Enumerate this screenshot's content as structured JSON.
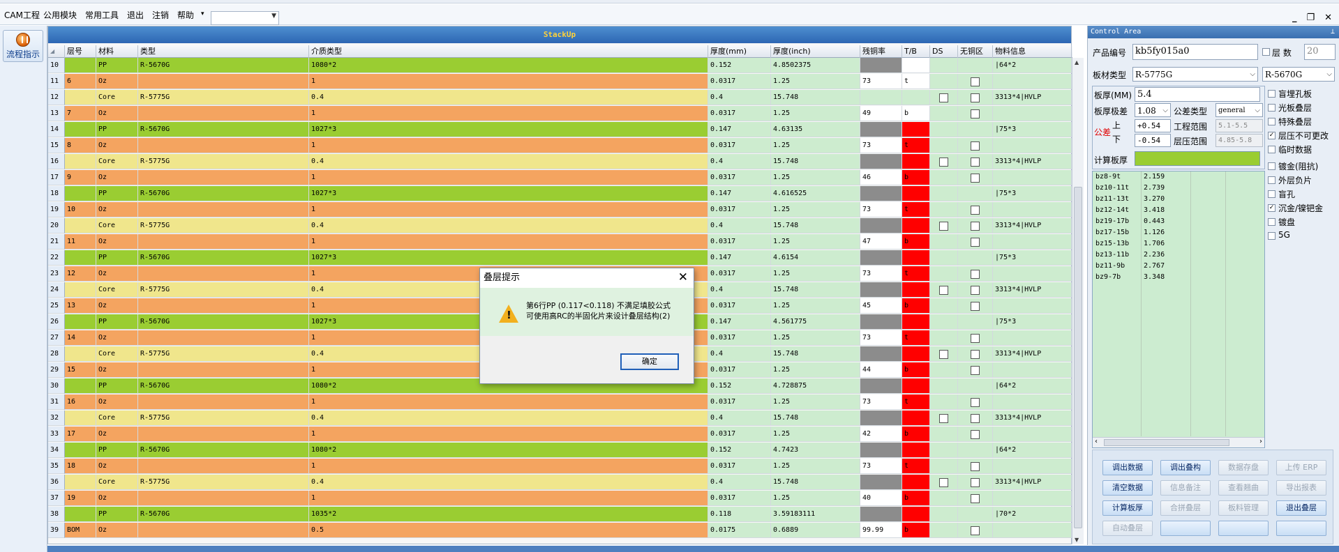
{
  "menubar": {
    "items": [
      "CAM工程",
      "公用模块",
      "常用工具",
      "退出",
      "注销",
      "帮助"
    ],
    "help_arrow": "▾"
  },
  "window_controls": [
    "_",
    "❐",
    "✕"
  ],
  "left_panel": {
    "flow_button": "流程指示"
  },
  "grid": {
    "title": "StackUp",
    "columns": [
      "层号",
      "材料",
      "类型",
      "介质类型",
      "厚度(mm)",
      "厚度(inch)",
      "残铜率",
      "T/B",
      "DS",
      "无铜区",
      "物料信息"
    ],
    "rows": [
      {
        "num": "10",
        "layer": "",
        "mat": "PP",
        "type": "R-5670G",
        "diel": "1080*2",
        "mm": "0.152",
        "inch": "4.8502375",
        "cu": "",
        "cuStyle": "gray",
        "tb": "",
        "tbStyle": "white",
        "ds": false,
        "nocu": false,
        "info": "|64*2",
        "color": "green"
      },
      {
        "num": "11",
        "layer": "6",
        "mat": "Oz",
        "type": "",
        "diel": "1",
        "mm": "0.0317",
        "inch": "1.25",
        "cu": "73",
        "cuStyle": "white",
        "tb": "t",
        "tbStyle": "white",
        "ds": null,
        "nocu": true,
        "info": "",
        "color": "orange"
      },
      {
        "num": "12",
        "layer": "",
        "mat": "Core",
        "type": "R-5775G",
        "diel": "0.4",
        "mm": "0.4",
        "inch": "15.748",
        "cu": "",
        "cuStyle": "none",
        "tb": "",
        "tbStyle": "none",
        "ds": true,
        "nocu": true,
        "info": "3313*4|HVLP",
        "color": "yellow"
      },
      {
        "num": "13",
        "layer": "7",
        "mat": "Oz",
        "type": "",
        "diel": "1",
        "mm": "0.0317",
        "inch": "1.25",
        "cu": "49",
        "cuStyle": "white",
        "tb": "b",
        "tbStyle": "white",
        "ds": null,
        "nocu": true,
        "info": "",
        "color": "orange"
      },
      {
        "num": "14",
        "layer": "",
        "mat": "PP",
        "type": "R-5670G",
        "diel": "1027*3",
        "mm": "0.147",
        "inch": "4.63135",
        "cu": "",
        "cuStyle": "gray",
        "tb": "",
        "tbStyle": "red",
        "ds": false,
        "nocu": false,
        "info": "|75*3",
        "color": "green"
      },
      {
        "num": "15",
        "layer": "8",
        "mat": "Oz",
        "type": "",
        "diel": "1",
        "mm": "0.0317",
        "inch": "1.25",
        "cu": "73",
        "cuStyle": "white",
        "tb": "t",
        "tbStyle": "red",
        "ds": null,
        "nocu": true,
        "info": "",
        "color": "orange"
      },
      {
        "num": "16",
        "layer": "",
        "mat": "Core",
        "type": "R-5775G",
        "diel": "0.4",
        "mm": "0.4",
        "inch": "15.748",
        "cu": "",
        "cuStyle": "gray",
        "tb": "",
        "tbStyle": "red",
        "ds": true,
        "nocu": true,
        "info": "3313*4|HVLP",
        "color": "yellow"
      },
      {
        "num": "17",
        "layer": "9",
        "mat": "Oz",
        "type": "",
        "diel": "1",
        "mm": "0.0317",
        "inch": "1.25",
        "cu": "46",
        "cuStyle": "white",
        "tb": "b",
        "tbStyle": "red",
        "ds": null,
        "nocu": true,
        "info": "",
        "color": "orange"
      },
      {
        "num": "18",
        "layer": "",
        "mat": "PP",
        "type": "R-5670G",
        "diel": "1027*3",
        "mm": "0.147",
        "inch": "4.616525",
        "cu": "",
        "cuStyle": "gray",
        "tb": "",
        "tbStyle": "red",
        "ds": false,
        "nocu": false,
        "info": "|75*3",
        "color": "green"
      },
      {
        "num": "19",
        "layer": "10",
        "mat": "Oz",
        "type": "",
        "diel": "1",
        "mm": "0.0317",
        "inch": "1.25",
        "cu": "73",
        "cuStyle": "white",
        "tb": "t",
        "tbStyle": "red",
        "ds": null,
        "nocu": true,
        "info": "",
        "color": "orange"
      },
      {
        "num": "20",
        "layer": "",
        "mat": "Core",
        "type": "R-5775G",
        "diel": "0.4",
        "mm": "0.4",
        "inch": "15.748",
        "cu": "",
        "cuStyle": "gray",
        "tb": "",
        "tbStyle": "red",
        "ds": true,
        "nocu": true,
        "info": "3313*4|HVLP",
        "color": "yellow"
      },
      {
        "num": "21",
        "layer": "11",
        "mat": "Oz",
        "type": "",
        "diel": "1",
        "mm": "0.0317",
        "inch": "1.25",
        "cu": "47",
        "cuStyle": "white",
        "tb": "b",
        "tbStyle": "red",
        "ds": null,
        "nocu": true,
        "info": "",
        "color": "orange"
      },
      {
        "num": "22",
        "layer": "",
        "mat": "PP",
        "type": "R-5670G",
        "diel": "1027*3",
        "mm": "0.147",
        "inch": "4.6154",
        "cu": "",
        "cuStyle": "gray",
        "tb": "",
        "tbStyle": "red",
        "ds": false,
        "nocu": false,
        "info": "|75*3",
        "color": "green"
      },
      {
        "num": "23",
        "layer": "12",
        "mat": "Oz",
        "type": "",
        "diel": "1",
        "mm": "0.0317",
        "inch": "1.25",
        "cu": "73",
        "cuStyle": "white",
        "tb": "t",
        "tbStyle": "red",
        "ds": null,
        "nocu": true,
        "info": "",
        "color": "orange"
      },
      {
        "num": "24",
        "layer": "",
        "mat": "Core",
        "type": "R-5775G",
        "diel": "0.4",
        "mm": "0.4",
        "inch": "15.748",
        "cu": "",
        "cuStyle": "gray",
        "tb": "",
        "tbStyle": "red",
        "ds": true,
        "nocu": true,
        "info": "3313*4|HVLP",
        "color": "yellow"
      },
      {
        "num": "25",
        "layer": "13",
        "mat": "Oz",
        "type": "",
        "diel": "1",
        "mm": "0.0317",
        "inch": "1.25",
        "cu": "45",
        "cuStyle": "white",
        "tb": "b",
        "tbStyle": "red",
        "ds": null,
        "nocu": true,
        "info": "",
        "color": "orange"
      },
      {
        "num": "26",
        "layer": "",
        "mat": "PP",
        "type": "R-5670G",
        "diel": "1027*3",
        "mm": "0.147",
        "inch": "4.561775",
        "cu": "",
        "cuStyle": "gray",
        "tb": "",
        "tbStyle": "red",
        "ds": false,
        "nocu": false,
        "info": "|75*3",
        "color": "green"
      },
      {
        "num": "27",
        "layer": "14",
        "mat": "Oz",
        "type": "",
        "diel": "1",
        "mm": "0.0317",
        "inch": "1.25",
        "cu": "73",
        "cuStyle": "white",
        "tb": "t",
        "tbStyle": "red",
        "ds": null,
        "nocu": true,
        "info": "",
        "color": "orange"
      },
      {
        "num": "28",
        "layer": "",
        "mat": "Core",
        "type": "R-5775G",
        "diel": "0.4",
        "mm": "0.4",
        "inch": "15.748",
        "cu": "",
        "cuStyle": "gray",
        "tb": "",
        "tbStyle": "red",
        "ds": true,
        "nocu": true,
        "info": "3313*4|HVLP",
        "color": "yellow"
      },
      {
        "num": "29",
        "layer": "15",
        "mat": "Oz",
        "type": "",
        "diel": "1",
        "mm": "0.0317",
        "inch": "1.25",
        "cu": "44",
        "cuStyle": "white",
        "tb": "b",
        "tbStyle": "red",
        "ds": null,
        "nocu": true,
        "info": "",
        "color": "orange"
      },
      {
        "num": "30",
        "layer": "",
        "mat": "PP",
        "type": "R-5670G",
        "diel": "1080*2",
        "mm": "0.152",
        "inch": "4.728875",
        "cu": "",
        "cuStyle": "gray",
        "tb": "",
        "tbStyle": "red",
        "ds": false,
        "nocu": false,
        "info": "|64*2",
        "color": "green"
      },
      {
        "num": "31",
        "layer": "16",
        "mat": "Oz",
        "type": "",
        "diel": "1",
        "mm": "0.0317",
        "inch": "1.25",
        "cu": "73",
        "cuStyle": "white",
        "tb": "t",
        "tbStyle": "red",
        "ds": null,
        "nocu": true,
        "info": "",
        "color": "orange"
      },
      {
        "num": "32",
        "layer": "",
        "mat": "Core",
        "type": "R-5775G",
        "diel": "0.4",
        "mm": "0.4",
        "inch": "15.748",
        "cu": "",
        "cuStyle": "gray",
        "tb": "",
        "tbStyle": "red",
        "ds": true,
        "nocu": true,
        "info": "3313*4|HVLP",
        "color": "yellow"
      },
      {
        "num": "33",
        "layer": "17",
        "mat": "Oz",
        "type": "",
        "diel": "1",
        "mm": "0.0317",
        "inch": "1.25",
        "cu": "42",
        "cuStyle": "white",
        "tb": "b",
        "tbStyle": "red",
        "ds": null,
        "nocu": true,
        "info": "",
        "color": "orange"
      },
      {
        "num": "34",
        "layer": "",
        "mat": "PP",
        "type": "R-5670G",
        "diel": "1080*2",
        "mm": "0.152",
        "inch": "4.7423",
        "cu": "",
        "cuStyle": "gray",
        "tb": "",
        "tbStyle": "red",
        "ds": false,
        "nocu": false,
        "info": "|64*2",
        "color": "green"
      },
      {
        "num": "35",
        "layer": "18",
        "mat": "Oz",
        "type": "",
        "diel": "1",
        "mm": "0.0317",
        "inch": "1.25",
        "cu": "73",
        "cuStyle": "white",
        "tb": "t",
        "tbStyle": "red",
        "ds": null,
        "nocu": true,
        "info": "",
        "color": "orange"
      },
      {
        "num": "36",
        "layer": "",
        "mat": "Core",
        "type": "R-5775G",
        "diel": "0.4",
        "mm": "0.4",
        "inch": "15.748",
        "cu": "",
        "cuStyle": "gray",
        "tb": "",
        "tbStyle": "red",
        "ds": true,
        "nocu": true,
        "info": "3313*4|HVLP",
        "color": "yellow"
      },
      {
        "num": "37",
        "layer": "19",
        "mat": "Oz",
        "type": "",
        "diel": "1",
        "mm": "0.0317",
        "inch": "1.25",
        "cu": "40",
        "cuStyle": "white",
        "tb": "b",
        "tbStyle": "red",
        "ds": null,
        "nocu": true,
        "info": "",
        "color": "orange"
      },
      {
        "num": "38",
        "layer": "",
        "mat": "PP",
        "type": "R-5670G",
        "diel": "1035*2",
        "mm": "0.118",
        "inch": "3.59183111",
        "cu": "",
        "cuStyle": "gray",
        "tb": "",
        "tbStyle": "red",
        "ds": false,
        "nocu": false,
        "info": "|70*2",
        "color": "green"
      },
      {
        "num": "39",
        "layer": "BOM",
        "mat": "Oz",
        "type": "",
        "diel": "0.5",
        "mm": "0.0175",
        "inch": "0.6889",
        "cu": "99.99",
        "cuStyle": "white",
        "tb": "b",
        "tbStyle": "red",
        "ds": null,
        "nocu": true,
        "info": "",
        "color": "orange"
      }
    ]
  },
  "row_colors": {
    "green": "#9acd32",
    "orange": "#f4a460",
    "yellow": "#f0e68c",
    "light": "#cdeccf"
  },
  "control": {
    "title": "Control Area",
    "pin": "⊥",
    "product_label": "产品编号",
    "product_value": "kb5fy015a0",
    "layers_label": "层 数",
    "layers_value": "20",
    "board_type_label": "板材类型",
    "board_type_1": "R-5775G",
    "board_type_2": "R-5670G",
    "thickness_label": "板厚(MM)",
    "thickness_value": "5.4",
    "grade_label": "板厚极差",
    "grade_value": "1.08",
    "tol_type_label": "公差类型",
    "tol_type_value": "general",
    "tol_label": "公差",
    "upper_label": "上",
    "lower_label": "下",
    "upper_value": "+0.54",
    "lower_value": "-0.54",
    "eng_range_label": "工程范围",
    "eng_range_value": "5.1-5.5",
    "press_range_label": "层压范围",
    "press_range_value": "4.85-5.8",
    "calc_label": "计算板厚",
    "checks": [
      {
        "label": "盲埋孔板",
        "checked": false
      },
      {
        "label": "光板叠层",
        "checked": false
      },
      {
        "label": "特殊叠层",
        "checked": false
      },
      {
        "label": "层压不可更改",
        "checked": true
      },
      {
        "label": "临时数据",
        "checked": false
      },
      {
        "label": "镀金(阻抗)",
        "checked": false
      },
      {
        "label": "外层负片",
        "checked": false
      },
      {
        "label": "盲孔",
        "checked": false
      },
      {
        "label": "沉金/镍钯金",
        "checked": true
      },
      {
        "label": "镀盘",
        "checked": false
      },
      {
        "label": "5G",
        "checked": false
      }
    ],
    "bz_list": [
      {
        "name": "bz8-9t",
        "val": "2.159"
      },
      {
        "name": "bz10-11t",
        "val": "2.739"
      },
      {
        "name": "bz11-13t",
        "val": "3.270"
      },
      {
        "name": "bz12-14t",
        "val": "3.418"
      },
      {
        "name": "bz19-17b",
        "val": "0.443"
      },
      {
        "name": "bz17-15b",
        "val": "1.126"
      },
      {
        "name": "bz15-13b",
        "val": "1.706"
      },
      {
        "name": "bz13-11b",
        "val": "2.236"
      },
      {
        "name": "bz11-9b",
        "val": "2.767"
      },
      {
        "name": "bz9-7b",
        "val": "3.348"
      }
    ],
    "buttons": [
      {
        "label": "调出数据",
        "enabled": true
      },
      {
        "label": "调出叠构",
        "enabled": true
      },
      {
        "label": "数据存盘",
        "enabled": false
      },
      {
        "label": "上传 ERP",
        "enabled": false
      },
      {
        "label": "清空数据",
        "enabled": true
      },
      {
        "label": "信息备注",
        "enabled": false
      },
      {
        "label": "查看翘曲",
        "enabled": false
      },
      {
        "label": "导出报表",
        "enabled": false
      },
      {
        "label": "计算板厚",
        "enabled": true
      },
      {
        "label": "合拼叠层",
        "enabled": false
      },
      {
        "label": "板料管理",
        "enabled": false
      },
      {
        "label": "退出叠层",
        "enabled": true
      },
      {
        "label": "自动叠层",
        "enabled": false
      },
      {
        "label": "",
        "enabled": true
      },
      {
        "label": "",
        "enabled": true
      },
      {
        "label": "",
        "enabled": true
      }
    ]
  },
  "dialog": {
    "title": "叠层提示",
    "close": "✕",
    "line1": "第6行PP (0.117<0.118) 不满足填胶公式",
    "line2": "可使用高RC的半固化片来设计叠层结构(2)",
    "ok": "确定",
    "warn_glyph": "!"
  }
}
